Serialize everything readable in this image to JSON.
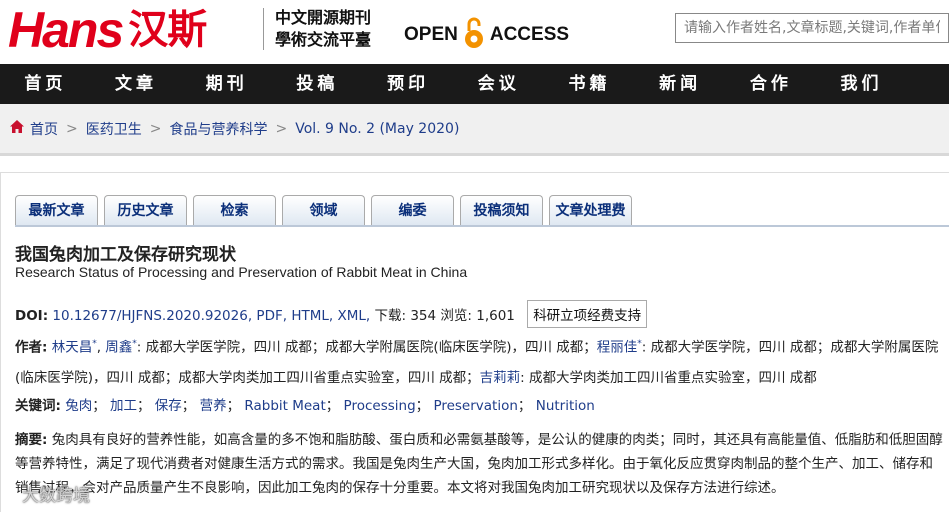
{
  "header": {
    "logo_text": "Hans",
    "logo_cn": "汉斯",
    "slogan_line1": "中文開源期刊",
    "slogan_line2": "學術交流平臺",
    "open_label": "OPEN",
    "access_label": "ACCESS",
    "search_placeholder": "请输入作者姓名,文章标题,关键词,作者单位"
  },
  "nav": [
    "首页",
    "文章",
    "期刊",
    "投稿",
    "预印",
    "会议",
    "书籍",
    "新闻",
    "合作",
    "我们"
  ],
  "breadcrumb": [
    "首页",
    "医药卫生",
    "食品与营养科学",
    "Vol. 9 No. 2 (May 2020)"
  ],
  "tabs": [
    "最新文章",
    "历史文章",
    "检索",
    "领域",
    "编委",
    "投稿须知",
    "文章处理费"
  ],
  "article": {
    "title_cn": "我国兔肉加工及保存研究现状",
    "title_en": "Research Status of Processing and Preservation of Rabbit Meat in China",
    "doi_label": "DOI:",
    "doi": "10.12677/HJFNS.2020.92026,",
    "pdf": "PDF,",
    "html": "HTML,",
    "xml": "XML,",
    "downloads": "下载: 354",
    "views": "浏览: 1,601",
    "fund_label": "科研立项经费支持",
    "authors_label": "作者:",
    "author1": "林天昌",
    "author2": "周鑫",
    "aff1": ": 成都大学医学院，四川 成都；成都大学附属医院(临床医学院)，四川 成都；",
    "author3": "程丽佳",
    "aff2": ": 成都大学医学院，四川 成都；成都大学附属医院(临床医学院)，四川 成都；成都大学肉类加工四川省重点实验室，四川 成都；",
    "author4": "吉莉莉",
    "aff3": ": 成都大学肉类加工四川省重点实验室，四川 成都",
    "star": "*",
    "comma": ", ",
    "keywords_label": "关键词:",
    "keywords": [
      "兔肉",
      "加工",
      "保存",
      "营养",
      "Rabbit Meat",
      "Processing",
      "Preservation",
      "Nutrition"
    ],
    "abstract_label": "摘要:",
    "abstract": "兔肉具有良好的营养性能，如高含量的多不饱和脂肪酸、蛋白质和必需氨基酸等，是公认的健康的肉类；同时，其还具有高能量值、低脂肪和低胆固醇等营养特性，满足了现代消费者对健康生活方式的需求。我国是兔肉生产大国，兔肉加工形式多样化。由于氧化反应贯穿肉制品的整个生产、加工、储存和销售过程，会对产品质量产生不良影响，因此加工兔肉的保存十分重要。本文将对我国兔肉加工研究现状以及保存方法进行综述。"
  },
  "watermark": "大数跨境",
  "colors": {
    "brand_red": "#e0001b",
    "nav_bg": "#1a1a1a",
    "link_blue": "#1f3d8a"
  }
}
